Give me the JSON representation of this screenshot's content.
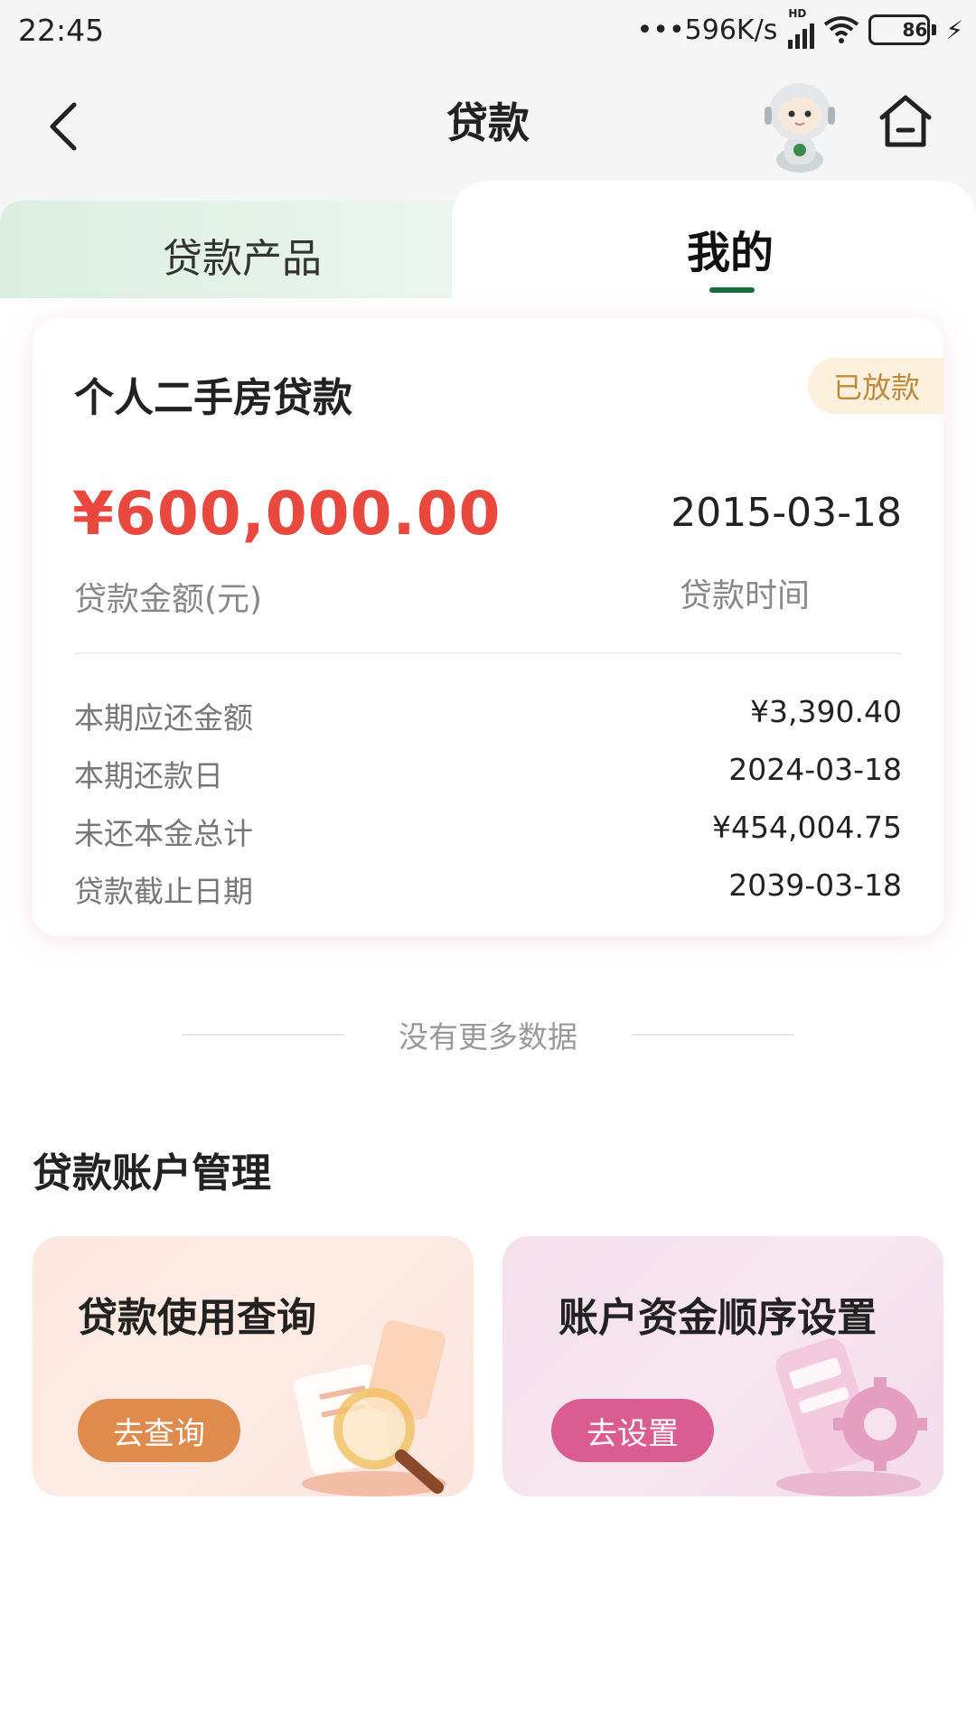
{
  "status_bar": {
    "time": "22:45",
    "net_speed": "•••596K/s",
    "hd": "HD",
    "battery": "86",
    "icons": [
      "signal-icon",
      "wifi-icon",
      "battery-icon",
      "charging-icon"
    ]
  },
  "header": {
    "title": "贷款",
    "icons": [
      "back-arrow-icon",
      "assistant-mascot-icon",
      "home-icon"
    ]
  },
  "tabs": [
    {
      "label": "贷款产品",
      "active": false
    },
    {
      "label": "我的",
      "active": true
    }
  ],
  "loan": {
    "name": "个人二手房贷款",
    "status": "已放款",
    "amount": "¥600,000.00",
    "amount_caption": "贷款金额(元)",
    "date": "2015-03-18",
    "date_caption": "贷款时间",
    "details": [
      {
        "label": "本期应还金额",
        "value": "¥3,390.40"
      },
      {
        "label": "本期还款日",
        "value": "2024-03-18"
      },
      {
        "label": "未还本金总计",
        "value": "¥454,004.75"
      },
      {
        "label": "贷款截止日期",
        "value": "2039-03-18"
      }
    ]
  },
  "no_more_text": "没有更多数据",
  "management": {
    "title": "贷款账户管理",
    "cards": [
      {
        "title": "贷款使用查询",
        "button": "去查询"
      },
      {
        "title": "账户资金顺序设置",
        "button": "去设置"
      }
    ]
  },
  "colors": {
    "accent_green": "#1a6b3f",
    "amount_red": "#e8483e",
    "badge_text": "#c08a3a",
    "query_button": "#df8b4e",
    "set_button": "#db5c91"
  }
}
